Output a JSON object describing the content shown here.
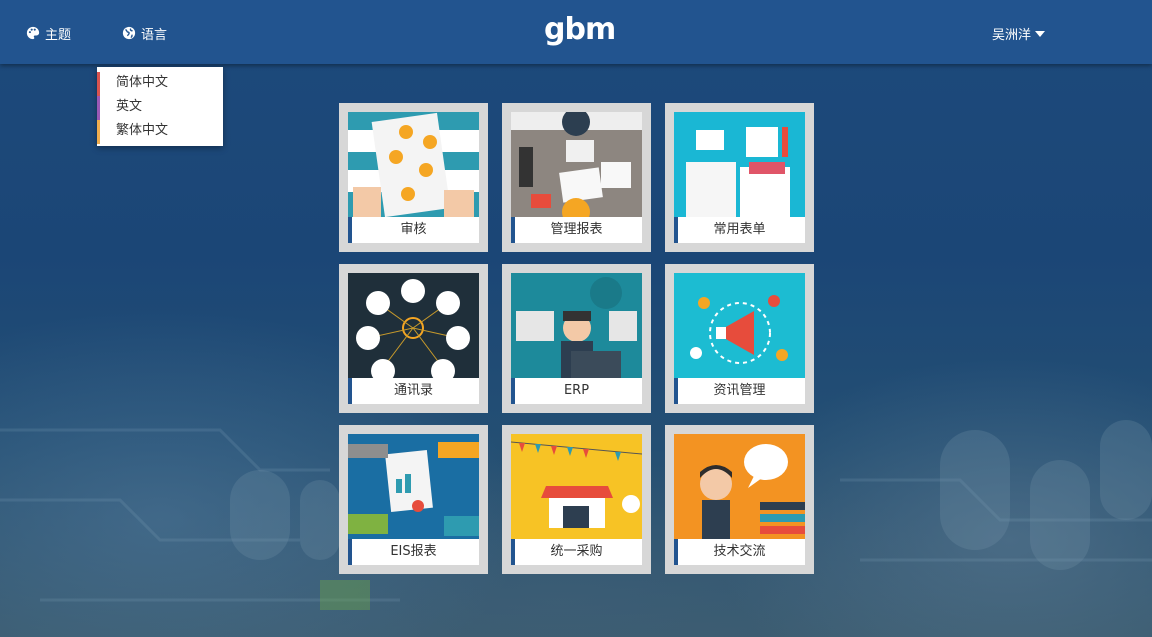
{
  "header": {
    "theme_label": "主题",
    "language_label": "语言",
    "logo_text": "gbm",
    "user_name": "吴洲洋"
  },
  "language_menu": {
    "items": [
      {
        "label": "简体中文",
        "color": "#d9534f"
      },
      {
        "label": "英文",
        "color": "#9b59b6"
      },
      {
        "label": "繁体中文",
        "color": "#f0ad4e"
      }
    ]
  },
  "tiles": [
    {
      "label": "审核",
      "icon": "document-review-illustration"
    },
    {
      "label": "管理报表",
      "icon": "desk-reports-illustration"
    },
    {
      "label": "常用表单",
      "icon": "forms-illustration"
    },
    {
      "label": "通讯录",
      "icon": "contacts-network-illustration"
    },
    {
      "label": "ERP",
      "icon": "erp-developer-illustration"
    },
    {
      "label": "资讯管理",
      "icon": "megaphone-illustration"
    },
    {
      "label": "EIS报表",
      "icon": "handshake-charts-illustration"
    },
    {
      "label": "统一采购",
      "icon": "shop-purchase-illustration"
    },
    {
      "label": "技术交流",
      "icon": "speech-bubble-illustration"
    }
  ],
  "colors": {
    "header_bg": "#22548f",
    "tile_frame": "#d7d7d7",
    "label_accent": "#22548f"
  }
}
